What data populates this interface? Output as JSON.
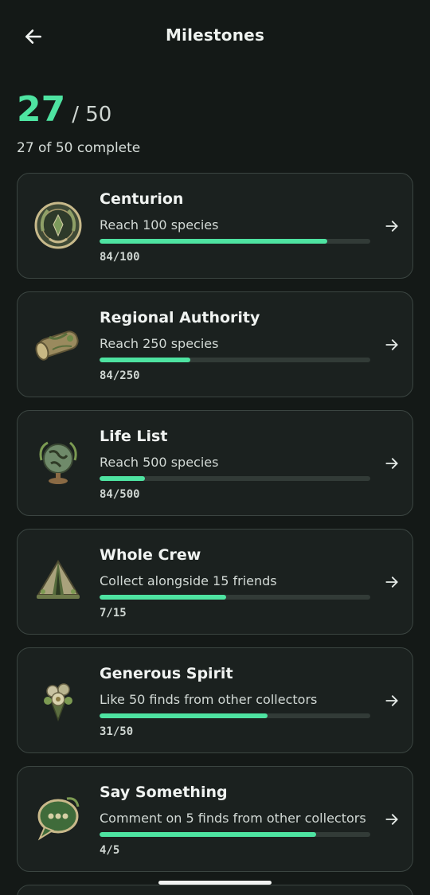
{
  "header": {
    "title": "Milestones",
    "back_icon": "arrow-left-icon"
  },
  "summary": {
    "completed": "27",
    "total": "/ 50",
    "subtitle": "27 of 50 complete"
  },
  "colors": {
    "background": "#141917",
    "card": "#1b211f",
    "accent": "#4ee3a1",
    "track": "#323b37"
  },
  "milestones": [
    {
      "name": "Centurion",
      "description": "Reach 100 species",
      "progress": "84/100",
      "fraction": 0.84,
      "icon": "laurel-wreath-badge-icon"
    },
    {
      "name": "Regional Authority",
      "description": "Reach 250 species",
      "progress": "84/250",
      "fraction": 0.336,
      "icon": "scroll-map-badge-icon"
    },
    {
      "name": "Life List",
      "description": "Reach 500 species",
      "progress": "84/500",
      "fraction": 0.168,
      "icon": "globe-badge-icon"
    },
    {
      "name": "Whole Crew",
      "description": "Collect alongside 15 friends",
      "progress": "7/15",
      "fraction": 0.4667,
      "icon": "tent-badge-icon"
    },
    {
      "name": "Generous Spirit",
      "description": "Like 50 finds from other collectors",
      "progress": "31/50",
      "fraction": 0.62,
      "icon": "flower-bouquet-badge-icon"
    },
    {
      "name": "Say Something",
      "description": "Comment on 5 finds from other collectors",
      "progress": "4/5",
      "fraction": 0.8,
      "icon": "speech-bubble-badge-icon"
    }
  ]
}
